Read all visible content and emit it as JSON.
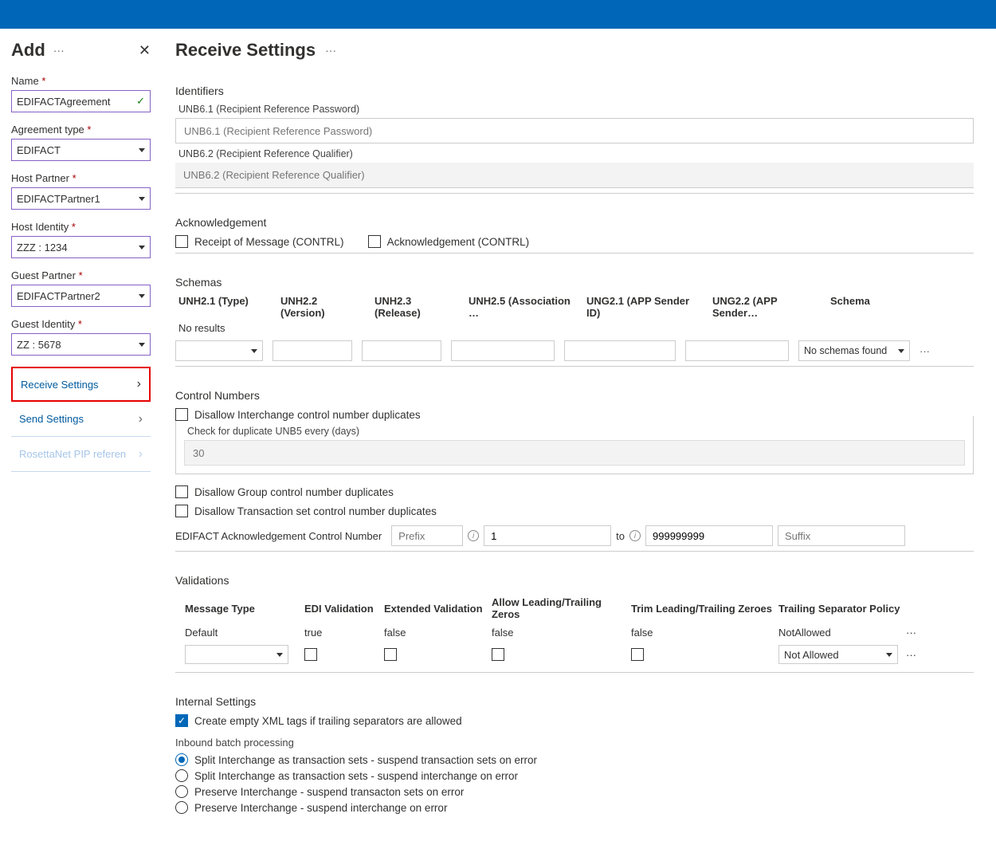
{
  "side": {
    "title": "Add",
    "fields": {
      "name_label": "Name",
      "name_value": "EDIFACTAgreement",
      "agreement_type_label": "Agreement type",
      "agreement_type_value": "EDIFACT",
      "host_partner_label": "Host Partner",
      "host_partner_value": "EDIFACTPartner1",
      "host_identity_label": "Host Identity",
      "host_identity_value": "ZZZ : 1234",
      "guest_partner_label": "Guest Partner",
      "guest_partner_value": "EDIFACTPartner2",
      "guest_identity_label": "Guest Identity",
      "guest_identity_value": "ZZ : 5678"
    },
    "nav": {
      "receive": "Receive Settings",
      "send": "Send Settings",
      "pip": "RosettaNet PIP referen"
    }
  },
  "main": {
    "title": "Receive Settings",
    "identifiers": {
      "title": "Identifiers",
      "unb61_label": "UNB6.1 (Recipient Reference Password)",
      "unb61_ph": "UNB6.1 (Recipient Reference Password)",
      "unb62_label": "UNB6.2 (Recipient Reference Qualifier)",
      "unb62_ph": "UNB6.2 (Recipient Reference Qualifier)"
    },
    "ack": {
      "title": "Acknowledgement",
      "receipt": "Receipt of Message (CONTRL)",
      "ackc": "Acknowledgement (CONTRL)"
    },
    "schemas": {
      "title": "Schemas",
      "cols": [
        "UNH2.1 (Type)",
        "UNH2.2 (Version)",
        "UNH2.3 (Release)",
        "UNH2.5 (Association …",
        "UNG2.1 (APP Sender ID)",
        "UNG2.2 (APP Sender…",
        "Schema"
      ],
      "no_results": "No results",
      "no_schemas": "No schemas found"
    },
    "ctrl": {
      "title": "Control Numbers",
      "disallow_interchange": "Disallow Interchange control number duplicates",
      "check_label": "Check for duplicate UNB5 every (days)",
      "check_value": "30",
      "disallow_group": "Disallow Group control number duplicates",
      "disallow_txn": "Disallow Transaction set control number duplicates",
      "acn_label": "EDIFACT Acknowledgement Control Number",
      "prefix_ph": "Prefix",
      "from_value": "1",
      "to": "to",
      "to_value": "999999999",
      "suffix_ph": "Suffix"
    },
    "val": {
      "title": "Validations",
      "cols": [
        "Message Type",
        "EDI Validation",
        "Extended Validation",
        "Allow Leading/Trailing Zeros",
        "Trim Leading/Trailing Zeroes",
        "Trailing Separator Policy"
      ],
      "row": [
        "Default",
        "true",
        "false",
        "false",
        "false",
        "NotAllowed"
      ],
      "sel_value": "Not Allowed"
    },
    "internal": {
      "title": "Internal Settings",
      "empty_xml": "Create empty XML tags if trailing separators are allowed",
      "batch_label": "Inbound batch processing",
      "opts": [
        "Split Interchange as transaction sets - suspend transaction sets on error",
        "Split Interchange as transaction sets - suspend interchange on error",
        "Preserve Interchange - suspend transacton sets on error",
        "Preserve Interchange - suspend interchange on error"
      ]
    }
  }
}
